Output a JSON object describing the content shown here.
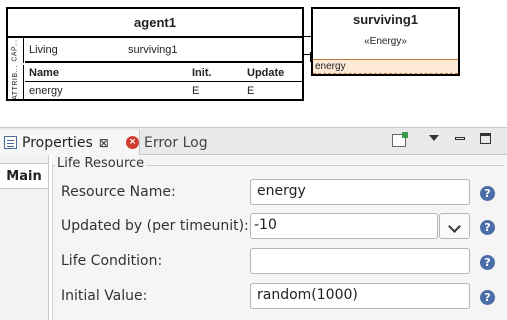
{
  "diagram": {
    "agent": {
      "title": "agent1",
      "capabilities_label": "CAP...",
      "attributes_label": "ATTRIB...",
      "capability": {
        "name": "Living",
        "value": "surviving1"
      },
      "attribute_headers": {
        "name": "Name",
        "init": "Init.",
        "update": "Update"
      },
      "attribute_row": {
        "name": "energy",
        "init": "E",
        "update": "E"
      }
    },
    "surviving": {
      "title": "surviving1",
      "stereotype": "«Energy»",
      "attribute": "energy"
    }
  },
  "tabs": {
    "properties": "Properties",
    "error_log": "Error Log",
    "close_symbol": "⊠"
  },
  "side_tabs": {
    "main": "Main"
  },
  "form": {
    "group_title": "Life Resource",
    "rows": [
      {
        "label": "Resource Name:",
        "value": "energy"
      },
      {
        "label": "Updated by (per timeunit):",
        "value": "-10"
      },
      {
        "label": "Life Condition:",
        "value": ""
      },
      {
        "label": "Initial Value:",
        "value": "random(1000)"
      }
    ],
    "help_symbol": "?"
  },
  "icons": {
    "properties_tab": "properties-list-icon",
    "error_log_tab": "error-log-icon",
    "edit": "edit-icon",
    "view_menu": "view-menu-icon",
    "minimize": "minimize-icon",
    "maximize": "maximize-icon",
    "help": "help-icon",
    "dropdown": "chevron-down-icon"
  },
  "colors": {
    "help_blue": "#4b6ea8",
    "highlight_attr": "#fde9d6",
    "error_red": "#d23b2f"
  }
}
